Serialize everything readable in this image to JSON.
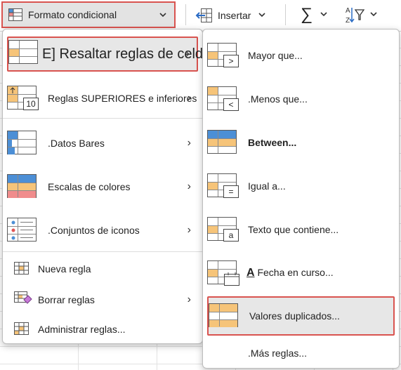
{
  "ribbon": {
    "conditional_format_label": "Formato condicional",
    "insert_label": "Insertar",
    "sum_symbol": "∑",
    "sort_glyph": "A↓Z"
  },
  "main_menu": {
    "items": [
      {
        "label": "E] Resaltar reglas de celdas",
        "has_submenu": true,
        "highlighted": true
      },
      {
        "label": "Reglas SUPERIORES e inferiores",
        "has_submenu": true,
        "badge": "10"
      },
      {
        "label": ".Datos  Bares",
        "has_submenu": true
      },
      {
        "label": "Escalas de colores",
        "has_submenu": true
      },
      {
        "label": ".Conjuntos de iconos",
        "has_submenu": true
      }
    ],
    "actions": [
      {
        "label": "Nueva regla",
        "has_submenu": false
      },
      {
        "label": "Borrar reglas",
        "has_submenu": true
      },
      {
        "label": "Administrar reglas...",
        "has_submenu": false
      }
    ]
  },
  "sub_menu": {
    "items": [
      {
        "label": "Mayor que...",
        "badge": ">"
      },
      {
        "label": ".Menos que...",
        "badge": "<"
      },
      {
        "label": "Between...",
        "bold": true
      },
      {
        "label": "Igual a...",
        "badge": "="
      },
      {
        "label": "Texto que contiene...",
        "badge": "a"
      },
      {
        "label": "Fecha en curso...",
        "prefix": "A"
      },
      {
        "label": "Valores duplicados...",
        "highlighted": true
      },
      {
        "label": ".Más reglas..."
      }
    ]
  },
  "colors": {
    "highlight_border": "#d9534f",
    "orange": "#f6c479",
    "blue": "#4c8fd6",
    "red": "#f08c8c"
  }
}
